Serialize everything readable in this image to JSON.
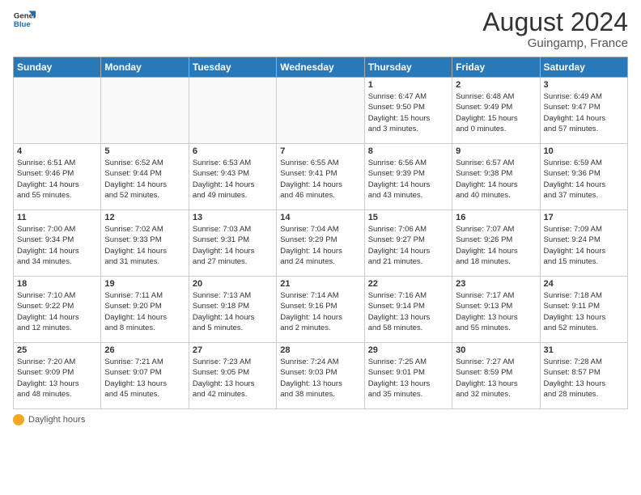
{
  "header": {
    "logo_general": "General",
    "logo_blue": "Blue",
    "month_year": "August 2024",
    "location": "Guingamp, France"
  },
  "days_of_week": [
    "Sunday",
    "Monday",
    "Tuesday",
    "Wednesday",
    "Thursday",
    "Friday",
    "Saturday"
  ],
  "footer": {
    "daylight_label": "Daylight hours"
  },
  "weeks": [
    [
      {
        "day": "",
        "info": ""
      },
      {
        "day": "",
        "info": ""
      },
      {
        "day": "",
        "info": ""
      },
      {
        "day": "",
        "info": ""
      },
      {
        "day": "1",
        "info": "Sunrise: 6:47 AM\nSunset: 9:50 PM\nDaylight: 15 hours\nand 3 minutes."
      },
      {
        "day": "2",
        "info": "Sunrise: 6:48 AM\nSunset: 9:49 PM\nDaylight: 15 hours\nand 0 minutes."
      },
      {
        "day": "3",
        "info": "Sunrise: 6:49 AM\nSunset: 9:47 PM\nDaylight: 14 hours\nand 57 minutes."
      }
    ],
    [
      {
        "day": "4",
        "info": "Sunrise: 6:51 AM\nSunset: 9:46 PM\nDaylight: 14 hours\nand 55 minutes."
      },
      {
        "day": "5",
        "info": "Sunrise: 6:52 AM\nSunset: 9:44 PM\nDaylight: 14 hours\nand 52 minutes."
      },
      {
        "day": "6",
        "info": "Sunrise: 6:53 AM\nSunset: 9:43 PM\nDaylight: 14 hours\nand 49 minutes."
      },
      {
        "day": "7",
        "info": "Sunrise: 6:55 AM\nSunset: 9:41 PM\nDaylight: 14 hours\nand 46 minutes."
      },
      {
        "day": "8",
        "info": "Sunrise: 6:56 AM\nSunset: 9:39 PM\nDaylight: 14 hours\nand 43 minutes."
      },
      {
        "day": "9",
        "info": "Sunrise: 6:57 AM\nSunset: 9:38 PM\nDaylight: 14 hours\nand 40 minutes."
      },
      {
        "day": "10",
        "info": "Sunrise: 6:59 AM\nSunset: 9:36 PM\nDaylight: 14 hours\nand 37 minutes."
      }
    ],
    [
      {
        "day": "11",
        "info": "Sunrise: 7:00 AM\nSunset: 9:34 PM\nDaylight: 14 hours\nand 34 minutes."
      },
      {
        "day": "12",
        "info": "Sunrise: 7:02 AM\nSunset: 9:33 PM\nDaylight: 14 hours\nand 31 minutes."
      },
      {
        "day": "13",
        "info": "Sunrise: 7:03 AM\nSunset: 9:31 PM\nDaylight: 14 hours\nand 27 minutes."
      },
      {
        "day": "14",
        "info": "Sunrise: 7:04 AM\nSunset: 9:29 PM\nDaylight: 14 hours\nand 24 minutes."
      },
      {
        "day": "15",
        "info": "Sunrise: 7:06 AM\nSunset: 9:27 PM\nDaylight: 14 hours\nand 21 minutes."
      },
      {
        "day": "16",
        "info": "Sunrise: 7:07 AM\nSunset: 9:26 PM\nDaylight: 14 hours\nand 18 minutes."
      },
      {
        "day": "17",
        "info": "Sunrise: 7:09 AM\nSunset: 9:24 PM\nDaylight: 14 hours\nand 15 minutes."
      }
    ],
    [
      {
        "day": "18",
        "info": "Sunrise: 7:10 AM\nSunset: 9:22 PM\nDaylight: 14 hours\nand 12 minutes."
      },
      {
        "day": "19",
        "info": "Sunrise: 7:11 AM\nSunset: 9:20 PM\nDaylight: 14 hours\nand 8 minutes."
      },
      {
        "day": "20",
        "info": "Sunrise: 7:13 AM\nSunset: 9:18 PM\nDaylight: 14 hours\nand 5 minutes."
      },
      {
        "day": "21",
        "info": "Sunrise: 7:14 AM\nSunset: 9:16 PM\nDaylight: 14 hours\nand 2 minutes."
      },
      {
        "day": "22",
        "info": "Sunrise: 7:16 AM\nSunset: 9:14 PM\nDaylight: 13 hours\nand 58 minutes."
      },
      {
        "day": "23",
        "info": "Sunrise: 7:17 AM\nSunset: 9:13 PM\nDaylight: 13 hours\nand 55 minutes."
      },
      {
        "day": "24",
        "info": "Sunrise: 7:18 AM\nSunset: 9:11 PM\nDaylight: 13 hours\nand 52 minutes."
      }
    ],
    [
      {
        "day": "25",
        "info": "Sunrise: 7:20 AM\nSunset: 9:09 PM\nDaylight: 13 hours\nand 48 minutes."
      },
      {
        "day": "26",
        "info": "Sunrise: 7:21 AM\nSunset: 9:07 PM\nDaylight: 13 hours\nand 45 minutes."
      },
      {
        "day": "27",
        "info": "Sunrise: 7:23 AM\nSunset: 9:05 PM\nDaylight: 13 hours\nand 42 minutes."
      },
      {
        "day": "28",
        "info": "Sunrise: 7:24 AM\nSunset: 9:03 PM\nDaylight: 13 hours\nand 38 minutes."
      },
      {
        "day": "29",
        "info": "Sunrise: 7:25 AM\nSunset: 9:01 PM\nDaylight: 13 hours\nand 35 minutes."
      },
      {
        "day": "30",
        "info": "Sunrise: 7:27 AM\nSunset: 8:59 PM\nDaylight: 13 hours\nand 32 minutes."
      },
      {
        "day": "31",
        "info": "Sunrise: 7:28 AM\nSunset: 8:57 PM\nDaylight: 13 hours\nand 28 minutes."
      }
    ]
  ]
}
